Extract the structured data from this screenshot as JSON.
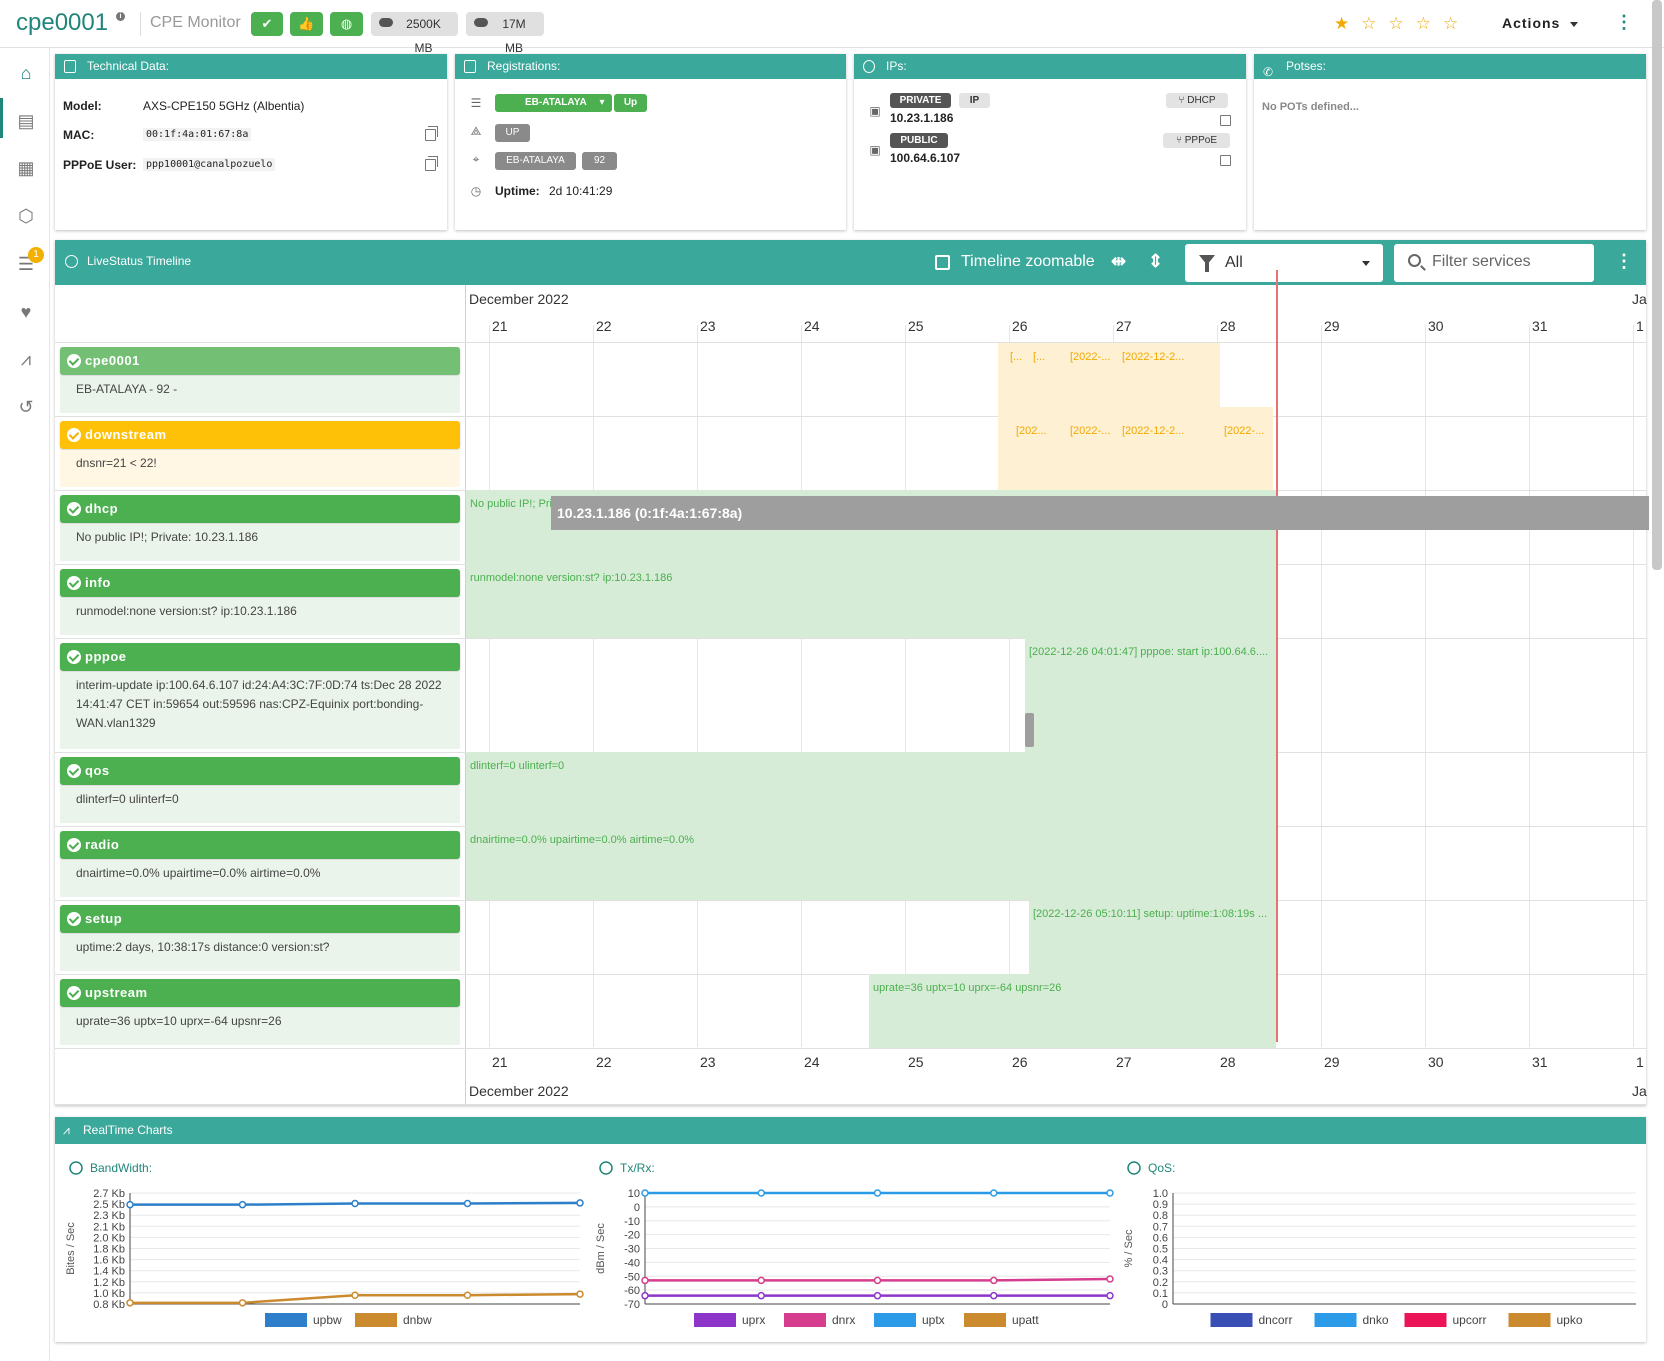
{
  "header": {
    "title": "cpe0001",
    "subtitle": "CPE Monitor",
    "download": "2500K MB",
    "upload": "17M MB",
    "actions_label": "Actions"
  },
  "tech": {
    "title": "Technical Data:",
    "model_label": "Model:",
    "model": "AXS-CPE150 5GHz (Albentia)",
    "mac_label": "MAC:",
    "mac": "00:1f:4a:01:67:8a",
    "pppoe_label": "PPPoE User:",
    "pppoe": "ppp10001@canalpozuelo"
  },
  "reg": {
    "title": "Registrations:",
    "station": "EB-ATALAYA",
    "state": "Up",
    "status": "UP",
    "tag1": "EB-ATALAYA",
    "tag2": "92",
    "uptime_label": "Uptime:",
    "uptime": "2d 10:41:29"
  },
  "ips": {
    "title": "IPs:",
    "private_label": "PRIVATE",
    "ip_tag": "IP",
    "private_ip": "10.23.1.186",
    "dhcp_label": "DHCP",
    "public_label": "PUBLIC",
    "public_ip": "100.64.6.107",
    "pppoe_label": "PPPoE"
  },
  "pots": {
    "title": "Potses:",
    "empty": "No POTs defined..."
  },
  "timeline": {
    "title": "LiveStatus Timeline",
    "zoomable_label": "Timeline zoomable",
    "filter_value": "All",
    "search_placeholder": "Filter services",
    "month": "December 2022",
    "month_next": "Ja",
    "days": [
      "21",
      "22",
      "23",
      "24",
      "25",
      "26",
      "27",
      "28",
      "29",
      "30",
      "31",
      "1"
    ],
    "tooltip": "10.23.1.186 (0:1f:4a:1:67:8a)",
    "services": [
      {
        "name": "cpe0001",
        "desc": "EB-ATALAYA - 92 -",
        "state": "ok"
      },
      {
        "name": "downstream",
        "desc": "dnsnr=21 < 22!",
        "state": "warning"
      },
      {
        "name": "dhcp",
        "desc": "No public IP!; Private: 10.23.1.186",
        "state": "ok"
      },
      {
        "name": "info",
        "desc": "runmodel:none version:st? ip:10.23.1.186",
        "state": "ok"
      },
      {
        "name": "pppoe",
        "desc": "interim-update ip:100.64.6.107 id:24:A4:3C:7F:0D:74 ts:Dec 28 2022 14:41:47 CET in:59654 out:59596 nas:CPZ-Equinix port:bonding-WAN.vlan1329",
        "state": "ok"
      },
      {
        "name": "qos",
        "desc": "dlinterf=0 ulinterf=0",
        "state": "ok"
      },
      {
        "name": "radio",
        "desc": "dnairtime=0.0% upairtime=0.0% airtime=0.0%",
        "state": "ok"
      },
      {
        "name": "setup",
        "desc": "uptime:2 days, 10:38:17s distance:0 version:st?",
        "state": "ok"
      },
      {
        "name": "upstream",
        "desc": "uprate=36 uptx=10 uprx=-64 upsnr=26",
        "state": "ok"
      }
    ],
    "segments": {
      "cpe": [
        "[...",
        "[...",
        "[2022-...",
        "[2022-12-2..."
      ],
      "down": [
        "[202...",
        "[2022-...",
        "[2022-12-2...",
        "[2022-..."
      ],
      "dhcp": "No public IP!; Private: 10.23.1.186",
      "info": "runmodel:none version:st? ip:10.23.1.186",
      "pppoe": "[2022-12-26 04:01:47] pppoe: start ip:100.64.6....",
      "qos": "dlinterf=0 ulinterf=0",
      "radio": "dnairtime=0.0% upairtime=0.0% airtime=0.0%",
      "setup": "[2022-12-26 05:10:11] setup: uptime:1:08:19s ...",
      "upstream": "uprate=36 uptx=10 uprx=-64 upsnr=26"
    }
  },
  "realtime": {
    "title": "RealTime Charts"
  },
  "chart_data": [
    {
      "type": "line",
      "title": "BandWidth:",
      "ylabel": "Bites / Sec",
      "yticks": [
        "2.7 Kb",
        "2.5 Kb",
        "2.3 Kb",
        "2.1 Kb",
        "2.0 Kb",
        "1.8 Kb",
        "1.6 Kb",
        "1.4 Kb",
        "1.2 Kb",
        "1.0 Kb",
        "0.8 Kb"
      ],
      "ylim": [
        0.8,
        2.7
      ],
      "x": [
        0,
        1,
        2,
        3,
        4
      ],
      "series": [
        {
          "name": "upbw",
          "color": "#2d7fc9",
          "values": [
            2.5,
            2.5,
            2.52,
            2.52,
            2.53
          ]
        },
        {
          "name": "dnbw",
          "color": "#cc8a2e",
          "values": [
            0.82,
            0.82,
            0.95,
            0.95,
            0.97
          ]
        }
      ]
    },
    {
      "type": "line",
      "title": "Tx/Rx:",
      "ylabel": "dBm / Sec",
      "yticks": [
        "10",
        "0",
        "-10",
        "-20",
        "-30",
        "-40",
        "-50",
        "-60",
        "-70"
      ],
      "ylim": [
        -70,
        10
      ],
      "x": [
        0,
        1,
        2,
        3,
        4
      ],
      "series": [
        {
          "name": "uprx",
          "color": "#8e35c9",
          "values": [
            -64,
            -64,
            -64,
            -64,
            -64
          ]
        },
        {
          "name": "dnrx",
          "color": "#d63d8e",
          "values": [
            -53,
            -53,
            -53,
            -53,
            -52
          ]
        },
        {
          "name": "uptx",
          "color": "#2b9be8",
          "values": [
            10,
            10,
            10,
            10,
            10
          ]
        },
        {
          "name": "upatt",
          "color": "#cc8a2e",
          "values": []
        }
      ]
    },
    {
      "type": "line",
      "title": "QoS:",
      "ylabel": "% / Sec",
      "yticks": [
        "1.0",
        "0.9",
        "0.8",
        "0.7",
        "0.6",
        "0.5",
        "0.4",
        "0.3",
        "0.2",
        "0.1",
        "0"
      ],
      "ylim": [
        0,
        1
      ],
      "x": [],
      "series": [
        {
          "name": "dncorr",
          "color": "#3a4fb5",
          "values": []
        },
        {
          "name": "dnko",
          "color": "#2b9be8",
          "values": []
        },
        {
          "name": "upcorr",
          "color": "#ea1457",
          "values": []
        },
        {
          "name": "upko",
          "color": "#cc8a2e",
          "values": []
        }
      ]
    }
  ]
}
